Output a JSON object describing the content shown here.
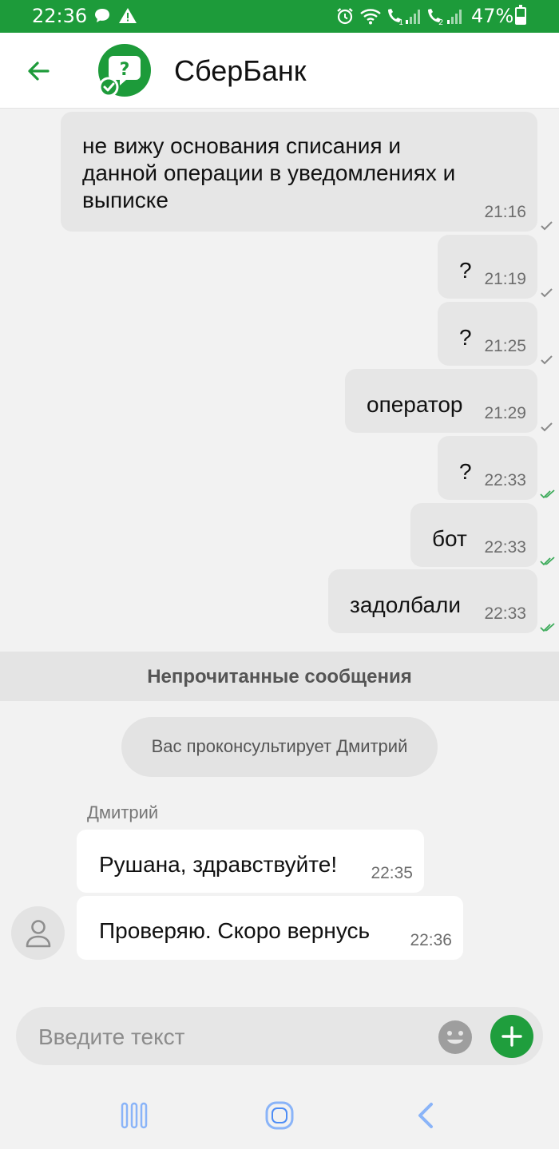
{
  "status_bar": {
    "time": "22:36",
    "battery_percent": "47%",
    "battery_level": 0.47,
    "icons": [
      "message-icon",
      "warning-icon",
      "alarm-icon",
      "wifi-icon",
      "sim1-signal-icon",
      "sim2-signal-icon",
      "battery-icon"
    ]
  },
  "header": {
    "title": "СберБанк",
    "back_icon": "arrow-left-icon",
    "logo_icon": "support-question-icon"
  },
  "outgoing_messages": [
    {
      "lines": [
        "не вижу основания списания и",
        "данной операции в уведомлениях и",
        "выписке"
      ],
      "time": "21:16",
      "status": "sent"
    },
    {
      "lines": [
        "?"
      ],
      "time": "21:19",
      "status": "sent"
    },
    {
      "lines": [
        "?"
      ],
      "time": "21:25",
      "status": "sent"
    },
    {
      "lines": [
        "оператор"
      ],
      "time": "21:29",
      "status": "sent"
    },
    {
      "lines": [
        "?"
      ],
      "time": "22:33",
      "status": "read"
    },
    {
      "lines": [
        "бот"
      ],
      "time": "22:33",
      "status": "read"
    },
    {
      "lines": [
        "задолбали"
      ],
      "time": "22:33",
      "status": "read"
    }
  ],
  "unread_divider": "Непрочитанные сообщения",
  "system_notice": "Вас проконсультирует Дмитрий",
  "operator": {
    "name": "Дмитрий",
    "avatar_icon": "user-avatar-icon"
  },
  "incoming_messages": [
    {
      "text": "Рушана, здравствуйте!",
      "time": "22:35"
    },
    {
      "text": "Проверяю. Скоро вернусь",
      "time": "22:36"
    }
  ],
  "composer": {
    "placeholder": "Введите текст",
    "emoji_icon": "emoji-icon",
    "add_icon": "plus-icon"
  },
  "nav_bar": {
    "icons": [
      "recent-apps-icon",
      "home-icon",
      "back-icon"
    ]
  },
  "colors": {
    "brand_green": "#1d9b3a",
    "read_tick": "#3cab5a",
    "sent_tick": "#8a8a8a"
  }
}
